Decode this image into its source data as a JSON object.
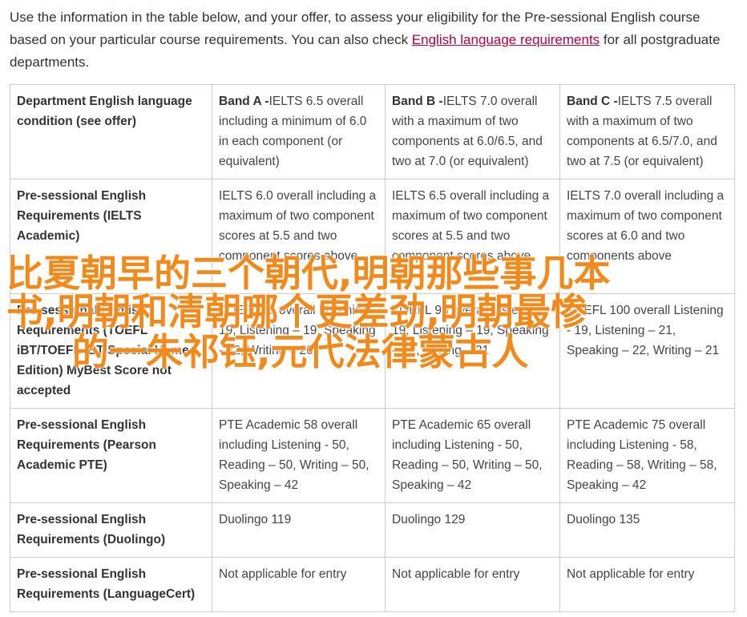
{
  "intro": {
    "before_link": "Use the information in the table below, and your offer, to assess your eligibility for the Pre-sessional English course based on your particular course requirements. You can also check ",
    "link_text": "English language requirements",
    "after_link": " for all postgraduate departments."
  },
  "table": {
    "header": {
      "col0": "Department English language condition (see offer)",
      "bands": [
        {
          "label": "Band A -",
          "text": "IELTS 6.5 overall including a minimum of 6.0 in each component (or equivalent)"
        },
        {
          "label": "Band B -",
          "text": "IELTS 7.0 overall with a maximum of two components at 6.0/6.5, and two at 7.0 (or equivalent)"
        },
        {
          "label": "Band C -",
          "text": "IELTS 7.5 overall with a maximum of two components at 6.5/7.0, and two at 7.5 (or equivalent)"
        }
      ]
    },
    "rows": [
      {
        "label": "Pre-sessional English Requirements (IELTS Academic)",
        "cells": [
          "IELTS 6.0 overall including a maximum of two component scores at 5.5 and two component scores above",
          "IELTS 6.5 overall including a maximum of two component scores at 5.5 and two component scores above",
          "IELTS 7.0 overall including a maximum of two component scores at 6.0 and two components above"
        ]
      },
      {
        "label": "Pre-sessional English Requirements (TOEFL iBT/TOEFL iBT Special Home Edition) MyBest Score not accepted",
        "cells": [
          "TOEFL 79 overall Listening - 19, Listening – 19, Speaking - 22, Writing – 20",
          "TOEFL 93 overall Listening - 19, Listening – 19, Speaking – 22, Writing – 21",
          "TOEFL 100 overall Listening - 19, Listening – 21, Speaking – 22, Writing – 21"
        ]
      },
      {
        "label": "Pre-sessional English Requirements (Pearson Academic PTE)",
        "cells": [
          "PTE Academic 58 overall including Listening - 50, Reading – 50, Writing – 50, Speaking – 42",
          "PTE Academic 65 overall including Listening - 50, Reading – 50, Writing – 50, Speaking – 42",
          "PTE Academic 75 overall including Listening - 58, Reading – 58, Writing – 58, Speaking – 42"
        ]
      },
      {
        "label": "Pre-sessional English Requirements (Duolingo)",
        "cells": [
          "Duolingo 119",
          "Duolingo 129",
          "Duolingo 135"
        ]
      },
      {
        "label": "Pre-sessional English Requirements (LanguageCert)",
        "cells": [
          "Not applicable for entry",
          "Not applicable for entry",
          "Not applicable for entry"
        ]
      }
    ]
  },
  "overlay": {
    "line1": "比夏朝早的三个朝代,明朝那些事几本",
    "line2": "书,明朝和清朝哪个更差劲,明朝最惨",
    "line3": "的一朱祁钰,元代法律蒙古人"
  },
  "colors": {
    "link": "#b3003c",
    "overlay_text": "#f08a1c",
    "border": "#cccccc"
  }
}
